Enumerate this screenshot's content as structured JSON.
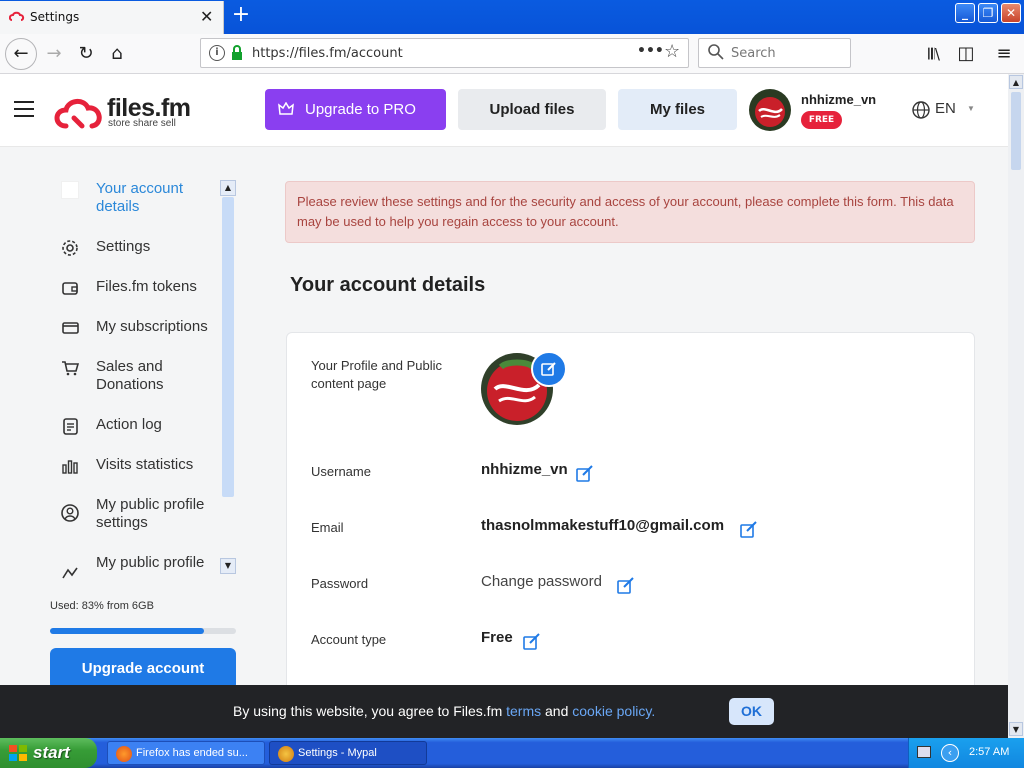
{
  "browser": {
    "tab_title": "Settings",
    "url": "https://files.fm/account",
    "search_placeholder": "Search"
  },
  "header": {
    "logo_text": "files.fm",
    "logo_tagline": "store share sell",
    "upgrade_label": "Upgrade to PRO",
    "upload_label": "Upload files",
    "myfiles_label": "My files",
    "username": "nhhizme_vn",
    "badge": "FREE",
    "language": "EN"
  },
  "sidebar": {
    "items": [
      {
        "label": "Your account details",
        "icon": "account-details-icon"
      },
      {
        "label": "Settings",
        "icon": "gear-icon"
      },
      {
        "label": "Files.fm tokens",
        "icon": "wallet-icon"
      },
      {
        "label": "My subscriptions",
        "icon": "card-icon"
      },
      {
        "label": "Sales and Donations",
        "icon": "cart-icon"
      },
      {
        "label": "Action log",
        "icon": "log-icon"
      },
      {
        "label": "Visits statistics",
        "icon": "bar-chart-icon"
      },
      {
        "label": "My public profile settings",
        "icon": "user-circle-icon"
      },
      {
        "label": "My public profile",
        "icon": "profile-icon"
      }
    ],
    "usage_text": "Used: 83% from 6GB",
    "usage_fraction": 0.83,
    "upgrade_button": "Upgrade account"
  },
  "main": {
    "alert": "Please review these settings and for the security and access of your account, please complete this form. This data may be used to help you regain access to your account.",
    "title": "Your account details",
    "rows": {
      "profile_label": "Your Profile and Public content page",
      "username_label": "Username",
      "username_value": "nhhizme_vn",
      "email_label": "Email",
      "email_value": "thasnolmmakestuff10@gmail.com",
      "password_label": "Password",
      "password_value": "Change password",
      "account_type_label": "Account type",
      "account_type_value": "Free"
    }
  },
  "cookie": {
    "text_before": "By using this website, you agree to Files.fm ",
    "terms": "terms",
    "and": " and ",
    "cookie_policy": "cookie policy.",
    "ok": "OK"
  },
  "taskbar": {
    "start": "start",
    "tasks": [
      "Firefox has ended su...",
      "Settings - Mypal"
    ],
    "time": "2:57 AM"
  },
  "colors": {
    "accent_blue": "#1f7ae6",
    "pro_purple": "#8a3ff0",
    "free_badge": "#e6223b"
  }
}
